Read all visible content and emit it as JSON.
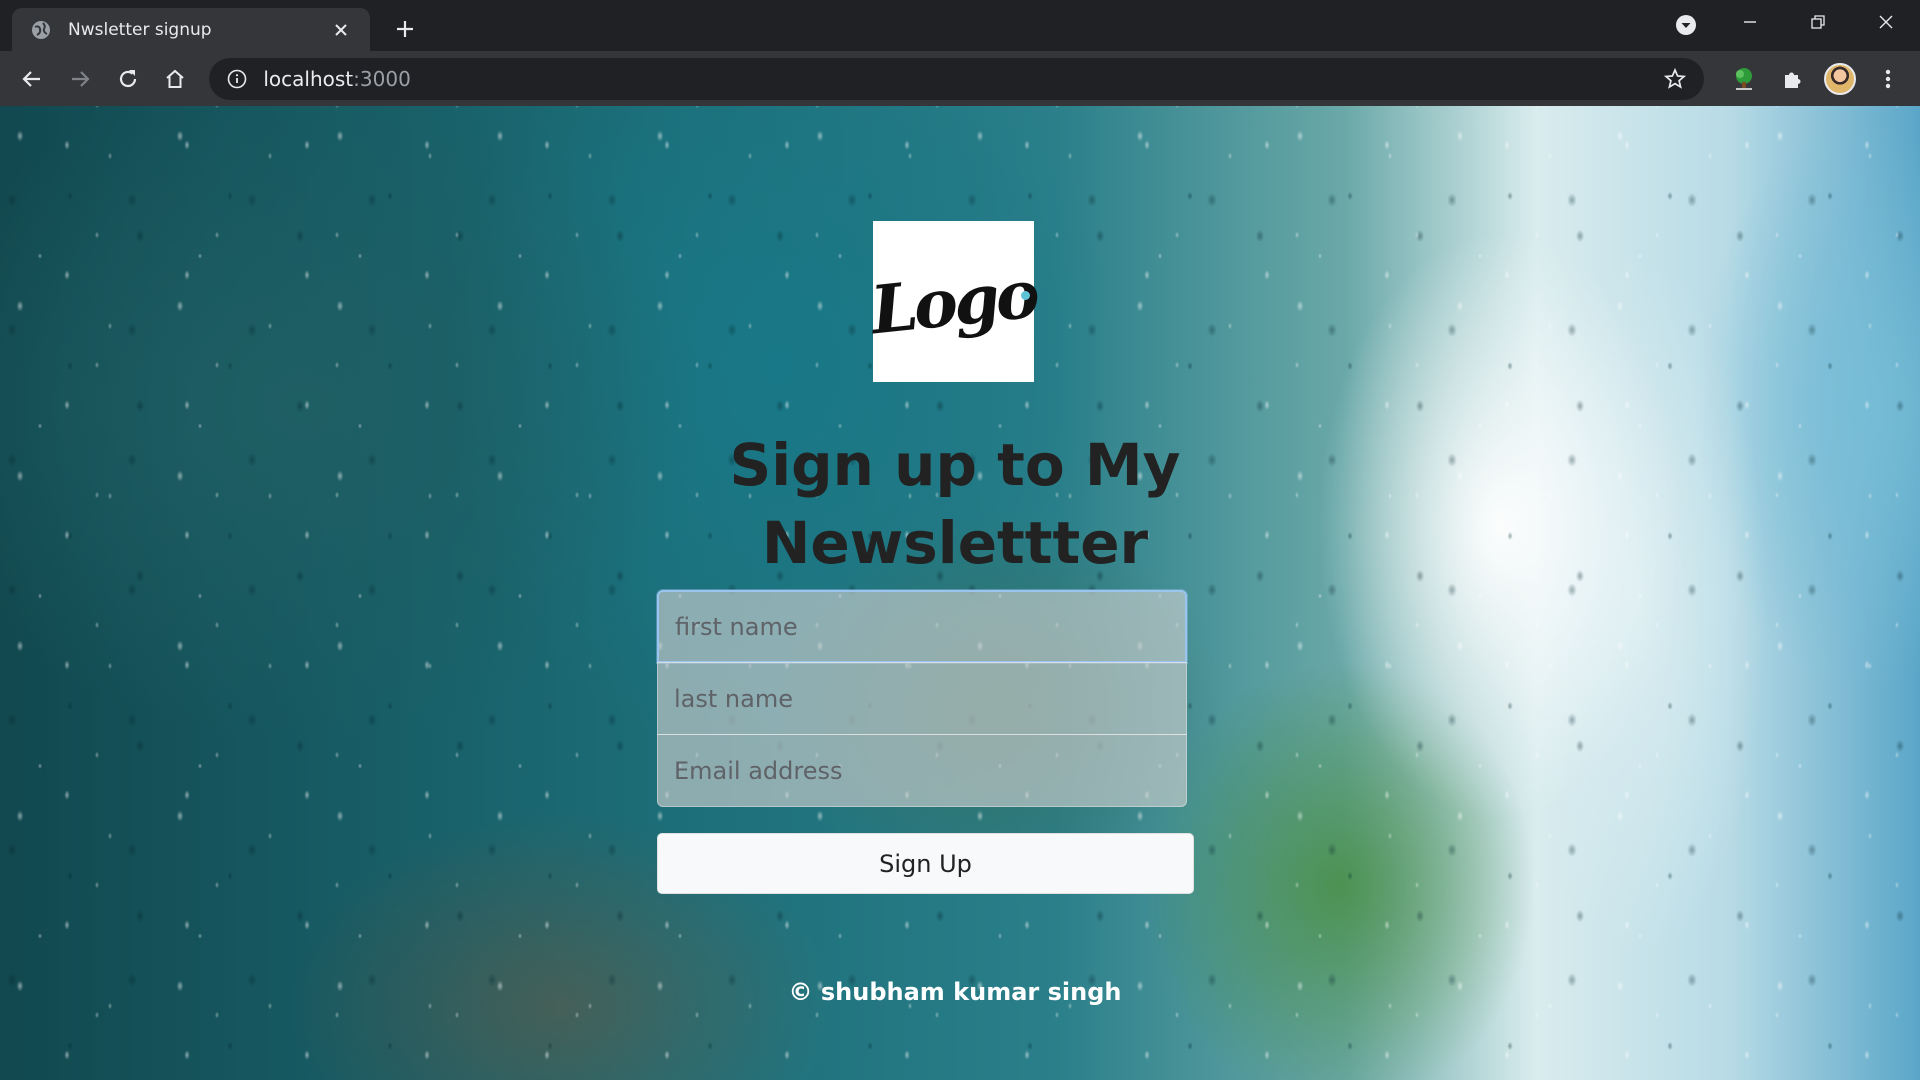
{
  "browser": {
    "tab_title": "Nwsletter signup",
    "url_host": "localhost",
    "url_port": ":3000"
  },
  "page": {
    "logo_text": "Logo",
    "heading": "Sign up to My Newslettter",
    "form": {
      "first_name_placeholder": "first name",
      "last_name_placeholder": "last name",
      "email_placeholder": "Email address"
    },
    "signup_button": "Sign Up",
    "footer": "© shubham kumar singh"
  },
  "colors": {
    "chrome_dark": "#202124",
    "chrome_toolbar": "#35363a",
    "heading_text": "#222222",
    "footer_text": "#ffffff"
  }
}
